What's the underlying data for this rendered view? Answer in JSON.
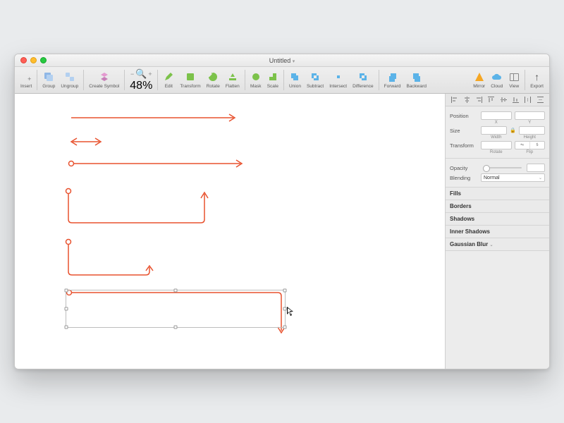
{
  "window": {
    "title": "Untitled"
  },
  "toolbar": {
    "insert": "Insert",
    "group": "Group",
    "ungroup": "Ungroup",
    "create_symbol": "Create Symbol",
    "zoom_pct": "48%",
    "edit": "Edit",
    "transform": "Transform",
    "rotate": "Rotate",
    "flatten": "Flatten",
    "mask": "Mask",
    "scale": "Scale",
    "union": "Union",
    "subtract": "Subtract",
    "intersect": "Intersect",
    "difference": "Difference",
    "forward": "Forward",
    "backward": "Backward",
    "mirror": "Mirror",
    "cloud": "Cloud",
    "view": "View",
    "export": "Export"
  },
  "inspector": {
    "position": "Position",
    "x": "X",
    "y": "Y",
    "size": "Size",
    "width": "Width",
    "height": "Height",
    "transform": "Transform",
    "rotate": "Rotate",
    "flip": "Flip",
    "opacity": "Opacity",
    "blending": "Blending",
    "blending_value": "Normal",
    "fills": "Fills",
    "borders": "Borders",
    "shadows": "Shadows",
    "inner_shadows": "Inner Shadows",
    "gaussian_blur": "Gaussian Blur"
  },
  "canvas": {
    "arrow_color": "#e8522f"
  }
}
